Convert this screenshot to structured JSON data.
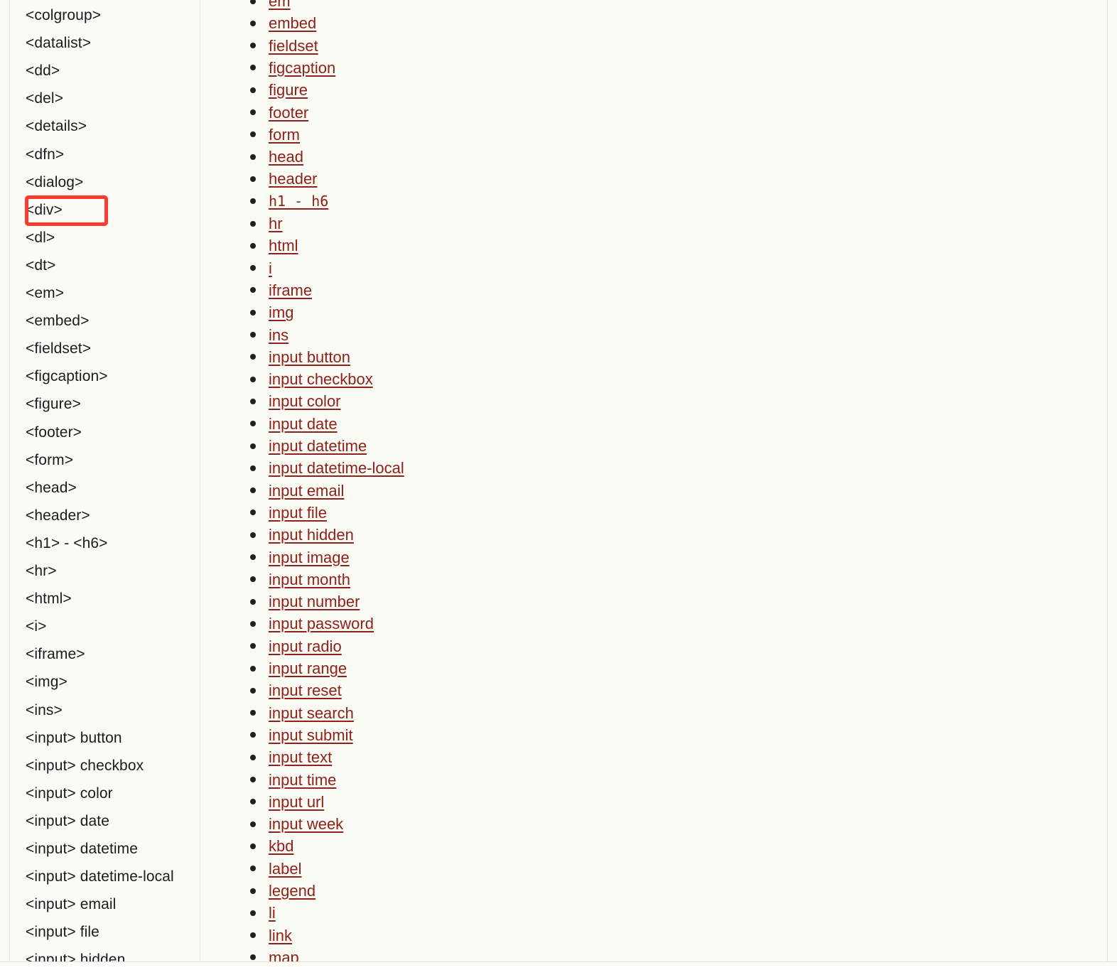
{
  "page": {
    "background_color": "#fbfbf6",
    "link_color": "#8f2118",
    "sidebar_text_color": "#1b1b1b",
    "highlight_color": "#fb3b30",
    "border_color": "#e6e6e2"
  },
  "sidebar": {
    "name": "html-tag-reference-sidebar",
    "highlighted_item": "<div>",
    "items": [
      {
        "label": "<colgroup>"
      },
      {
        "label": "<datalist>"
      },
      {
        "label": "<dd>"
      },
      {
        "label": "<del>"
      },
      {
        "label": "<details>"
      },
      {
        "label": "<dfn>"
      },
      {
        "label": "<dialog>"
      },
      {
        "label": "<div>"
      },
      {
        "label": "<dl>"
      },
      {
        "label": "<dt>"
      },
      {
        "label": "<em>"
      },
      {
        "label": "<embed>"
      },
      {
        "label": "<fieldset>"
      },
      {
        "label": "<figcaption>"
      },
      {
        "label": "<figure>"
      },
      {
        "label": "<footer>"
      },
      {
        "label": "<form>"
      },
      {
        "label": "<head>"
      },
      {
        "label": "<header>"
      },
      {
        "label": "<h1> - <h6>"
      },
      {
        "label": "<hr>"
      },
      {
        "label": "<html>"
      },
      {
        "label": "<i>"
      },
      {
        "label": "<iframe>"
      },
      {
        "label": "<img>"
      },
      {
        "label": "<ins>"
      },
      {
        "label": "<input> button"
      },
      {
        "label": "<input> checkbox"
      },
      {
        "label": "<input> color"
      },
      {
        "label": "<input> date"
      },
      {
        "label": "<input> datetime"
      },
      {
        "label": "<input> datetime-local"
      },
      {
        "label": "<input> email"
      },
      {
        "label": "<input> file"
      },
      {
        "label": "<input> hidden"
      }
    ]
  },
  "main": {
    "name": "html-element-link-list",
    "items": [
      {
        "label": "em",
        "mono": false
      },
      {
        "label": "embed",
        "mono": false
      },
      {
        "label": "fieldset",
        "mono": false
      },
      {
        "label": "figcaption",
        "mono": false
      },
      {
        "label": "figure",
        "mono": false
      },
      {
        "label": "footer",
        "mono": false
      },
      {
        "label": "form",
        "mono": false
      },
      {
        "label": "head",
        "mono": false
      },
      {
        "label": "header",
        "mono": false
      },
      {
        "label": "h1 - h6",
        "mono": true
      },
      {
        "label": "hr",
        "mono": false
      },
      {
        "label": "html",
        "mono": false
      },
      {
        "label": "i",
        "mono": false
      },
      {
        "label": "iframe",
        "mono": false
      },
      {
        "label": "img",
        "mono": false
      },
      {
        "label": "ins",
        "mono": false
      },
      {
        "label": "input button",
        "mono": false
      },
      {
        "label": "input checkbox",
        "mono": false
      },
      {
        "label": "input color",
        "mono": false
      },
      {
        "label": "input date",
        "mono": false
      },
      {
        "label": "input datetime",
        "mono": false
      },
      {
        "label": "input datetime-local",
        "mono": false
      },
      {
        "label": "input email",
        "mono": false
      },
      {
        "label": "input file",
        "mono": false
      },
      {
        "label": "input hidden",
        "mono": false
      },
      {
        "label": "input image",
        "mono": false
      },
      {
        "label": "input month",
        "mono": false
      },
      {
        "label": "input number",
        "mono": false
      },
      {
        "label": "input password",
        "mono": false
      },
      {
        "label": "input radio",
        "mono": false
      },
      {
        "label": "input range",
        "mono": false
      },
      {
        "label": "input reset",
        "mono": false
      },
      {
        "label": "input search",
        "mono": false
      },
      {
        "label": "input submit",
        "mono": false
      },
      {
        "label": "input text",
        "mono": false
      },
      {
        "label": "input time",
        "mono": false
      },
      {
        "label": "input url",
        "mono": false
      },
      {
        "label": "input week",
        "mono": false
      },
      {
        "label": "kbd",
        "mono": false
      },
      {
        "label": "label",
        "mono": false
      },
      {
        "label": "legend",
        "mono": false
      },
      {
        "label": "li",
        "mono": false
      },
      {
        "label": "link",
        "mono": false
      },
      {
        "label": "map",
        "mono": false
      }
    ]
  }
}
